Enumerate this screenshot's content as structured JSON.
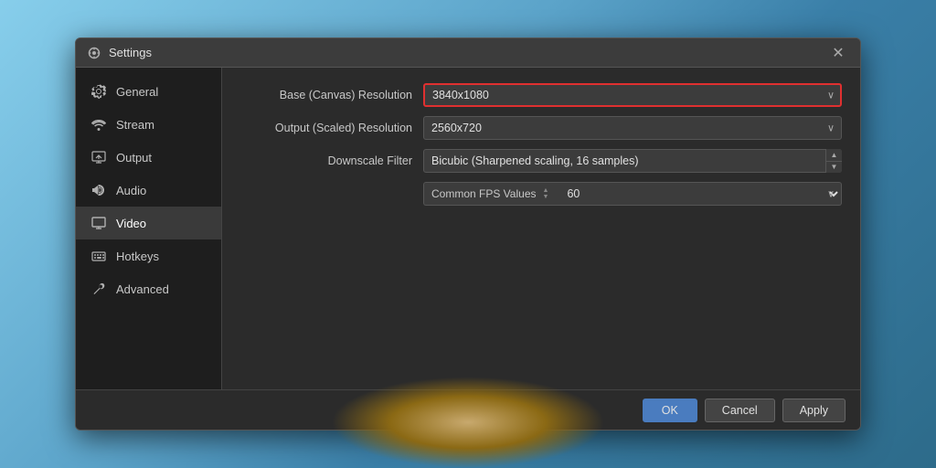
{
  "dialog": {
    "title": "Settings",
    "close_label": "✕"
  },
  "sidebar": {
    "items": [
      {
        "id": "general",
        "label": "General",
        "icon": "gear"
      },
      {
        "id": "stream",
        "label": "Stream",
        "icon": "wifi"
      },
      {
        "id": "output",
        "label": "Output",
        "icon": "monitor-out"
      },
      {
        "id": "audio",
        "label": "Audio",
        "icon": "speaker"
      },
      {
        "id": "video",
        "label": "Video",
        "icon": "monitor",
        "active": true
      },
      {
        "id": "hotkeys",
        "label": "Hotkeys",
        "icon": "keyboard"
      },
      {
        "id": "advanced",
        "label": "Advanced",
        "icon": "wrench"
      }
    ]
  },
  "video_settings": {
    "base_resolution": {
      "label": "Base (Canvas) Resolution",
      "value": "3840x1080",
      "highlighted": true
    },
    "output_resolution": {
      "label": "Output (Scaled) Resolution",
      "value": "2560x720"
    },
    "downscale_filter": {
      "label": "Downscale Filter",
      "value": "Bicubic (Sharpened scaling, 16 samples)"
    },
    "common_fps": {
      "label": "Common FPS Values",
      "value": "60"
    }
  },
  "footer": {
    "ok_label": "OK",
    "cancel_label": "Cancel",
    "apply_label": "Apply"
  }
}
